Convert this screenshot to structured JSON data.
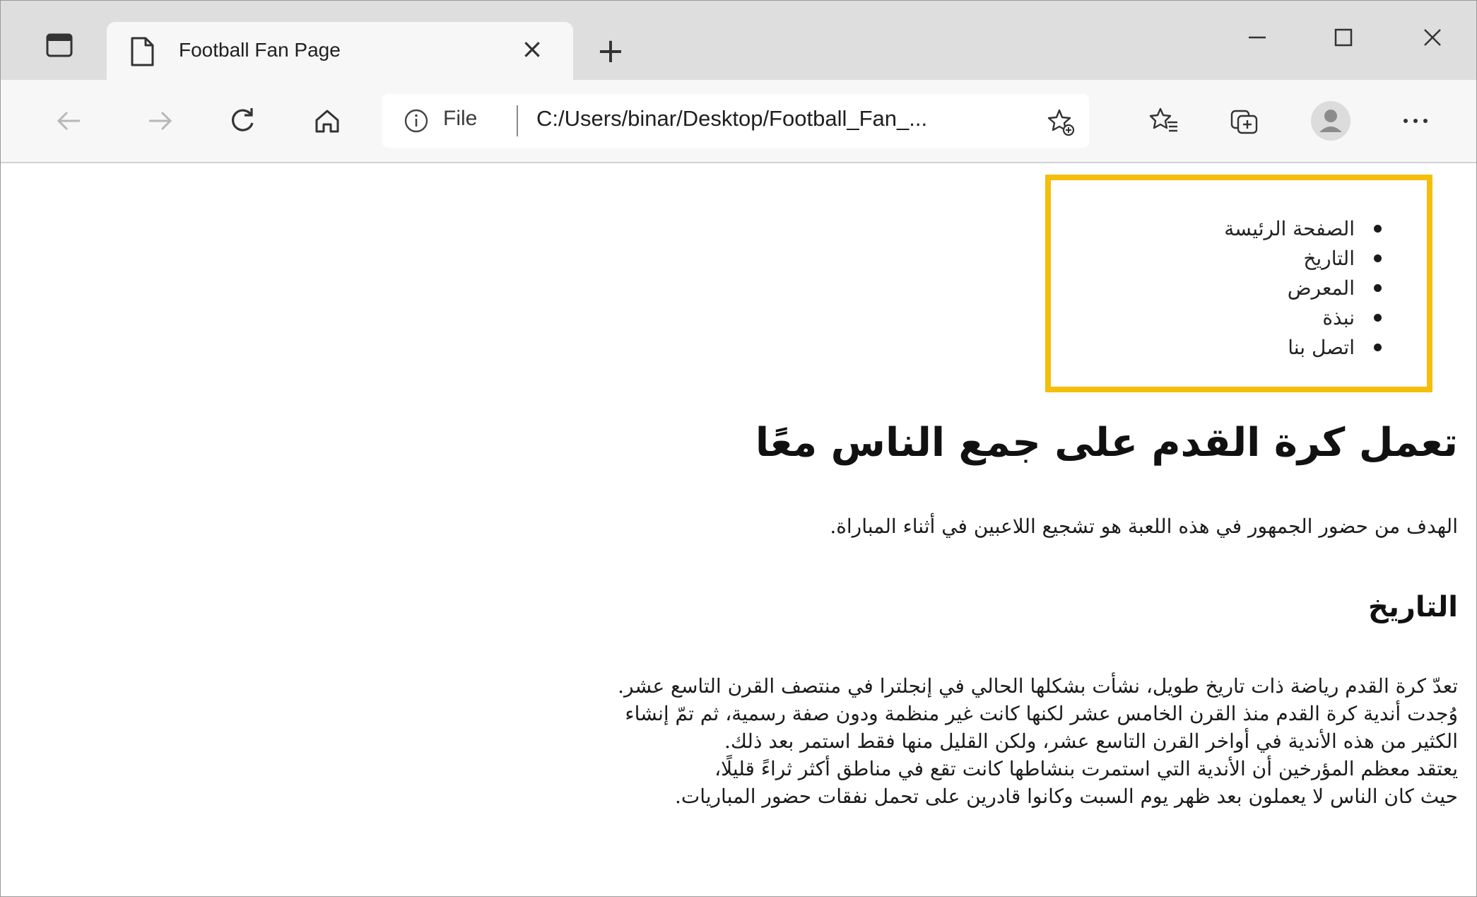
{
  "browser": {
    "tab": {
      "title": "Football Fan Page",
      "close_glyph": "×"
    },
    "new_tab_glyph": "+",
    "address": {
      "scheme_label": "File",
      "url": "C:/Users/binar/Desktop/Football_Fan_..."
    },
    "icons": {
      "tab_actions": "tab-actions-icon",
      "page": "page-icon",
      "back": "back-arrow-icon",
      "forward": "forward-arrow-icon",
      "refresh": "refresh-icon",
      "home": "home-icon",
      "info": "info-icon",
      "add_favorite": "add-favorite-icon",
      "favorites": "favorites-icon",
      "collections": "collections-icon",
      "profile": "profile-avatar-icon",
      "more": "more-icon",
      "minimize": "minimize-icon",
      "maximize": "maximize-icon",
      "close": "close-icon"
    }
  },
  "page": {
    "nav": {
      "items": [
        {
          "label": "الصفحة الرئيسة"
        },
        {
          "label": "التاريخ"
        },
        {
          "label": "المعرض"
        },
        {
          "label": "نبذة"
        },
        {
          "label": "اتصل بنا"
        }
      ]
    },
    "heading": "تعمل كرة القدم على جمع الناس معًا",
    "intro": "الهدف من حضور الجمهور في هذه اللعبة هو تشجيع اللاعبين في أثناء المباراة.",
    "history": {
      "heading": "التاريخ",
      "lines": [
        "تعدّ كرة القدم رياضة ذات تاريخ طويل، نشأت بشكلها الحالي في إنجلترا في منتصف القرن التاسع عشر.",
        "وُجدت أندية كرة القدم منذ القرن الخامس عشر لكنها كانت غير منظمة ودون صفة رسمية، ثم تمّ إنشاء",
        "الكثير من هذه الأندية في أواخر القرن التاسع عشر، ولكن القليل منها فقط استمر بعد ذلك.",
        "يعتقد معظم المؤرخين أن الأندية التي استمرت بنشاطها كانت تقع في مناطق أكثر ثراءً قليلًا،",
        "حيث كان الناس لا يعملون بعد ظهر يوم السبت وكانوا قادرين على تحمل نفقات حضور المباريات."
      ]
    },
    "colors": {
      "highlight_border": "#f5be0b",
      "tabstrip": "#dedede",
      "toolbar": "#f7f7f7"
    }
  }
}
